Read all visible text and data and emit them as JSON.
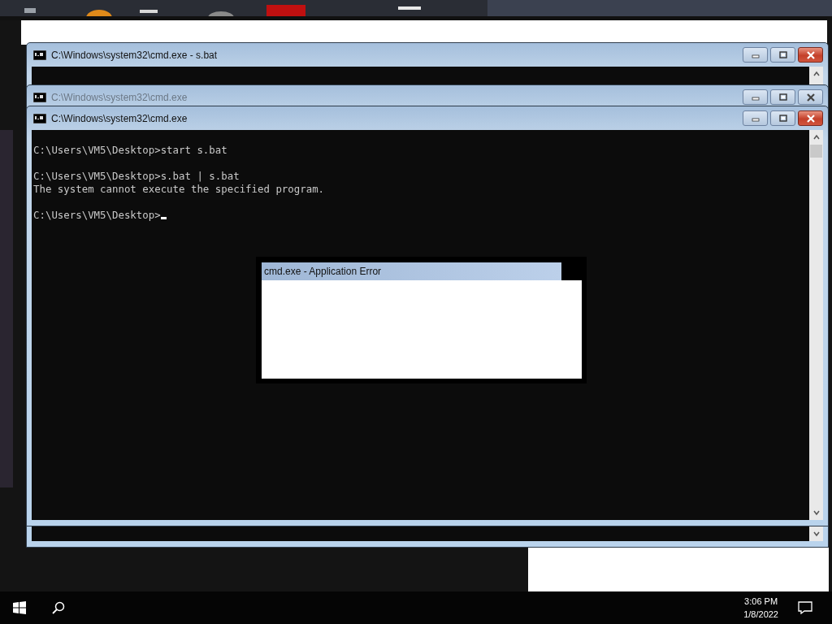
{
  "windows": [
    {
      "title": "C:\\Windows\\system32\\cmd.exe - s.bat",
      "active": true
    },
    {
      "title": "C:\\Windows\\system32\\cmd.exe",
      "active": false
    },
    {
      "title": "C:\\Windows\\system32\\cmd.exe",
      "active": true,
      "console": {
        "blocks": [
          [
            "C:\\Users\\VM5\\Desktop>start s.bat"
          ],
          [
            "C:\\Users\\VM5\\Desktop>s.bat | s.bat",
            "The system cannot execute the specified program."
          ],
          [
            "C:\\Users\\VM5\\Desktop>"
          ]
        ],
        "cursor": true
      }
    }
  ],
  "dialog": {
    "title": "cmd.exe - Application Error"
  },
  "taskbar": {
    "time": "3:06 PM",
    "date": "1/8/2022"
  }
}
